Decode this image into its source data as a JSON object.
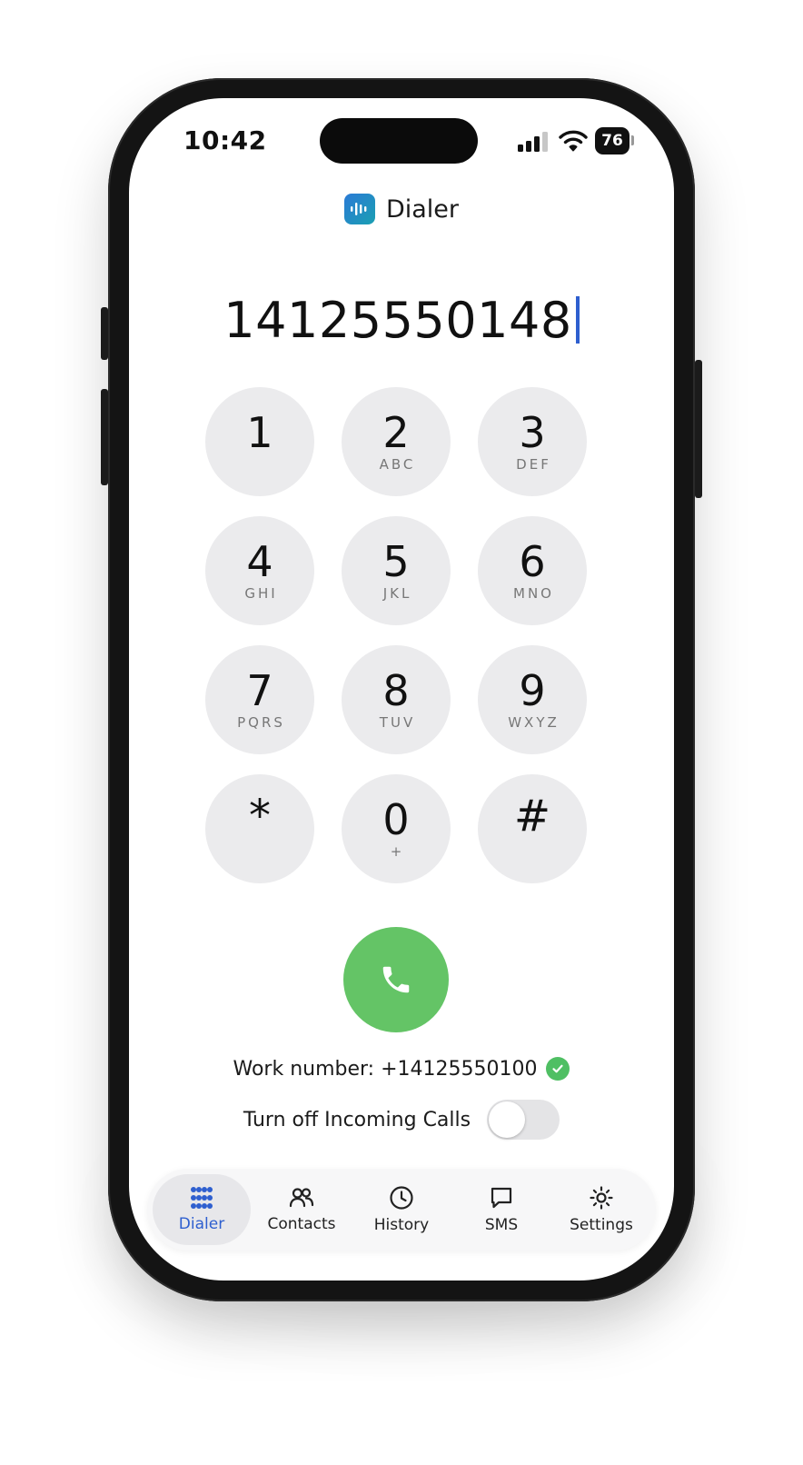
{
  "status_bar": {
    "time": "10:42",
    "battery": "76"
  },
  "app": {
    "title": "Dialer"
  },
  "dialer": {
    "number": "14125550148",
    "keys": [
      {
        "digit": "1",
        "letters": ""
      },
      {
        "digit": "2",
        "letters": "ABC"
      },
      {
        "digit": "3",
        "letters": "DEF"
      },
      {
        "digit": "4",
        "letters": "GHI"
      },
      {
        "digit": "5",
        "letters": "JKL"
      },
      {
        "digit": "6",
        "letters": "MNO"
      },
      {
        "digit": "7",
        "letters": "PQRS"
      },
      {
        "digit": "8",
        "letters": "TUV"
      },
      {
        "digit": "9",
        "letters": "WXYZ"
      },
      {
        "digit": "*",
        "letters": ""
      },
      {
        "digit": "0",
        "letters": "+"
      },
      {
        "digit": "#",
        "letters": ""
      }
    ]
  },
  "work_number": {
    "text": "Work number: +14125550100"
  },
  "incoming": {
    "label": "Turn off Incoming Calls",
    "enabled": false
  },
  "tabbar": {
    "tabs": [
      {
        "label": "Dialer",
        "icon": "keypad-grid-icon",
        "active": true
      },
      {
        "label": "Contacts",
        "icon": "people-icon",
        "active": false
      },
      {
        "label": "History",
        "icon": "clock-icon",
        "active": false
      },
      {
        "label": "SMS",
        "icon": "chat-bubble-icon",
        "active": false
      },
      {
        "label": "Settings",
        "icon": "sun-gear-icon",
        "active": false
      }
    ]
  },
  "colors": {
    "accent": "#2e5fcf",
    "call_green": "#64c466",
    "verified_green": "#4fbf63",
    "key_background": "#ebebed"
  }
}
